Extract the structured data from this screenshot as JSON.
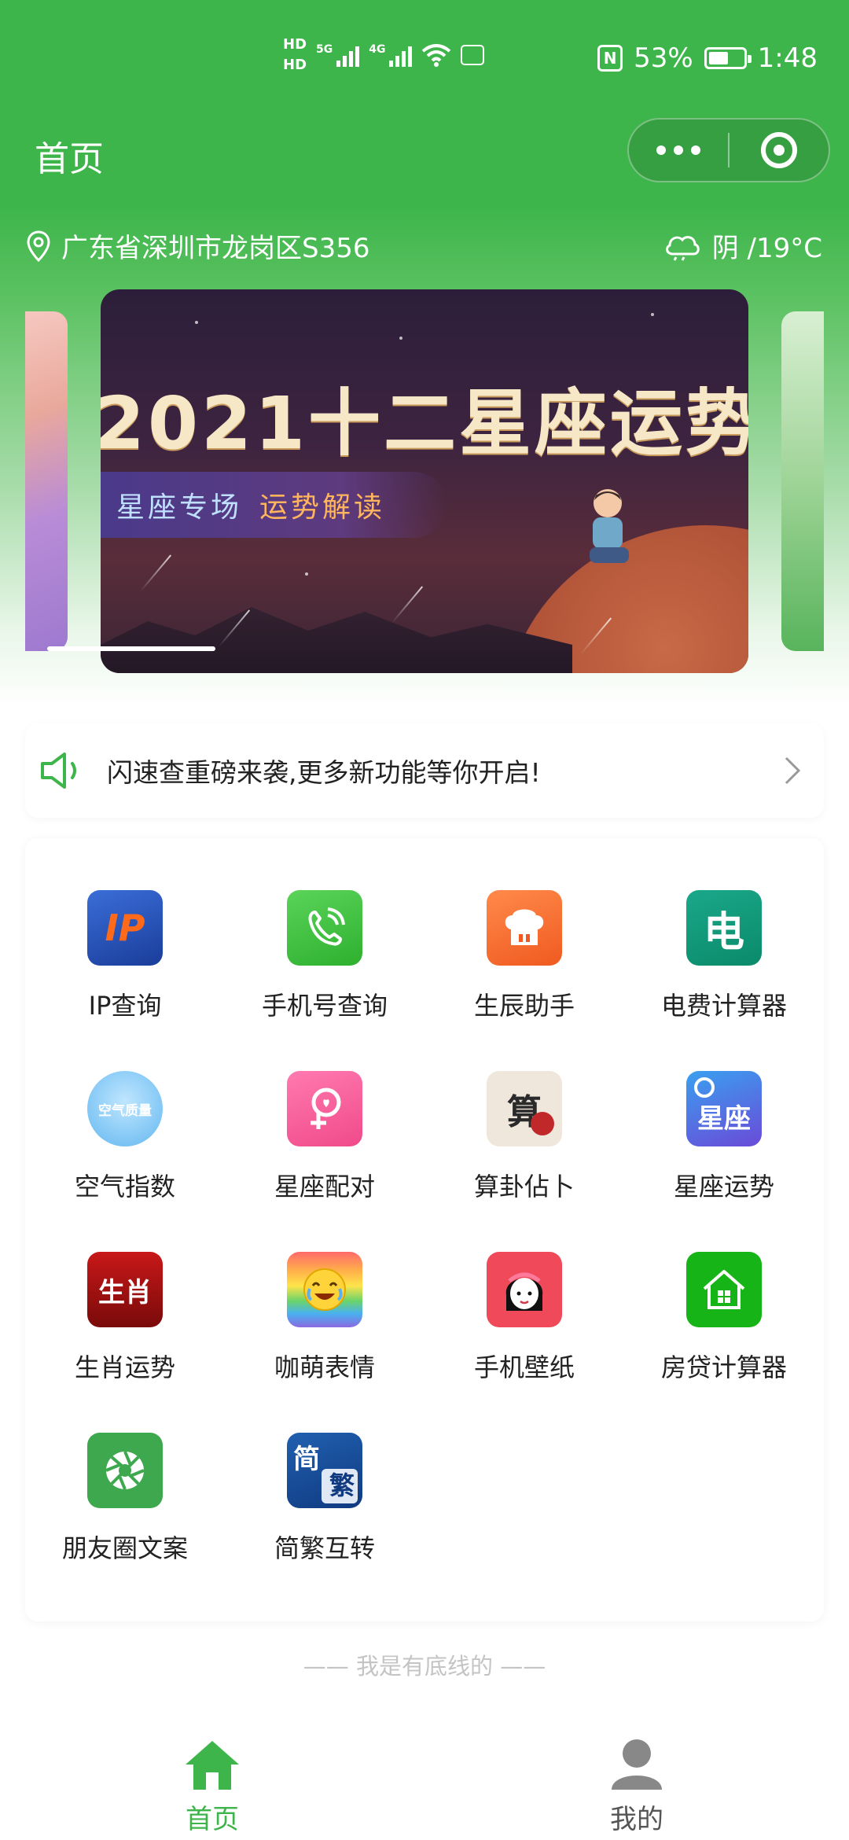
{
  "status_bar": {
    "hd1": "HD",
    "hd2": "HD",
    "net1": "5G",
    "net2": "4G",
    "battery": "53%",
    "time": "1:48",
    "icons": [
      "signal-icon",
      "wifi-icon",
      "nfc-icon",
      "battery-icon"
    ]
  },
  "nav": {
    "title": "首页",
    "more_icon": "more-dots-icon",
    "close_icon": "target-close-icon"
  },
  "location": {
    "text": "广东省深圳市龙岗区S356",
    "icon": "location-pin-icon"
  },
  "weather": {
    "text": "阴 /19°C",
    "icon": "cloud-icon"
  },
  "banner": {
    "title": "2021十二星座运势",
    "sub_a": "星座专场",
    "sub_b": "运势解读"
  },
  "notice": {
    "text": "闪速查重磅来袭,更多新功能等你开启!",
    "icon": "speaker-icon"
  },
  "apps": [
    {
      "label": "IP查询",
      "icon": "ip-icon"
    },
    {
      "label": "手机号查询",
      "icon": "phone-call-icon"
    },
    {
      "label": "生辰助手",
      "icon": "chef-hat-icon",
      "glyph": ""
    },
    {
      "label": "电费计算器",
      "icon": "electricity-icon",
      "glyph": "电"
    },
    {
      "label": "空气指数",
      "icon": "air-quality-icon",
      "glyph": "空气质量"
    },
    {
      "label": "星座配对",
      "icon": "zodiac-match-icon"
    },
    {
      "label": "算卦佔卜",
      "icon": "divination-icon",
      "glyph": "算"
    },
    {
      "label": "星座运势",
      "icon": "zodiac-fortune-icon",
      "glyph": "星座"
    },
    {
      "label": "生肖运势",
      "icon": "chinese-zodiac-icon",
      "glyph": "生肖"
    },
    {
      "label": "咖萌表情",
      "icon": "emoji-icon"
    },
    {
      "label": "手机壁纸",
      "icon": "wallpaper-girl-icon"
    },
    {
      "label": "房贷计算器",
      "icon": "house-loan-icon"
    },
    {
      "label": "朋友圈文案",
      "icon": "aperture-icon"
    },
    {
      "label": "简繁互转",
      "icon": "simplified-traditional-icon",
      "glyph_a": "简",
      "glyph_b": "繁"
    }
  ],
  "footer_line": "—— 我是有底线的 ——",
  "tabs": [
    {
      "label": "首页",
      "icon": "home-icon",
      "active": true
    },
    {
      "label": "我的",
      "icon": "user-icon",
      "active": false
    }
  ],
  "colors": {
    "brand_green": "#3db54a",
    "inactive_gray": "#555555"
  }
}
